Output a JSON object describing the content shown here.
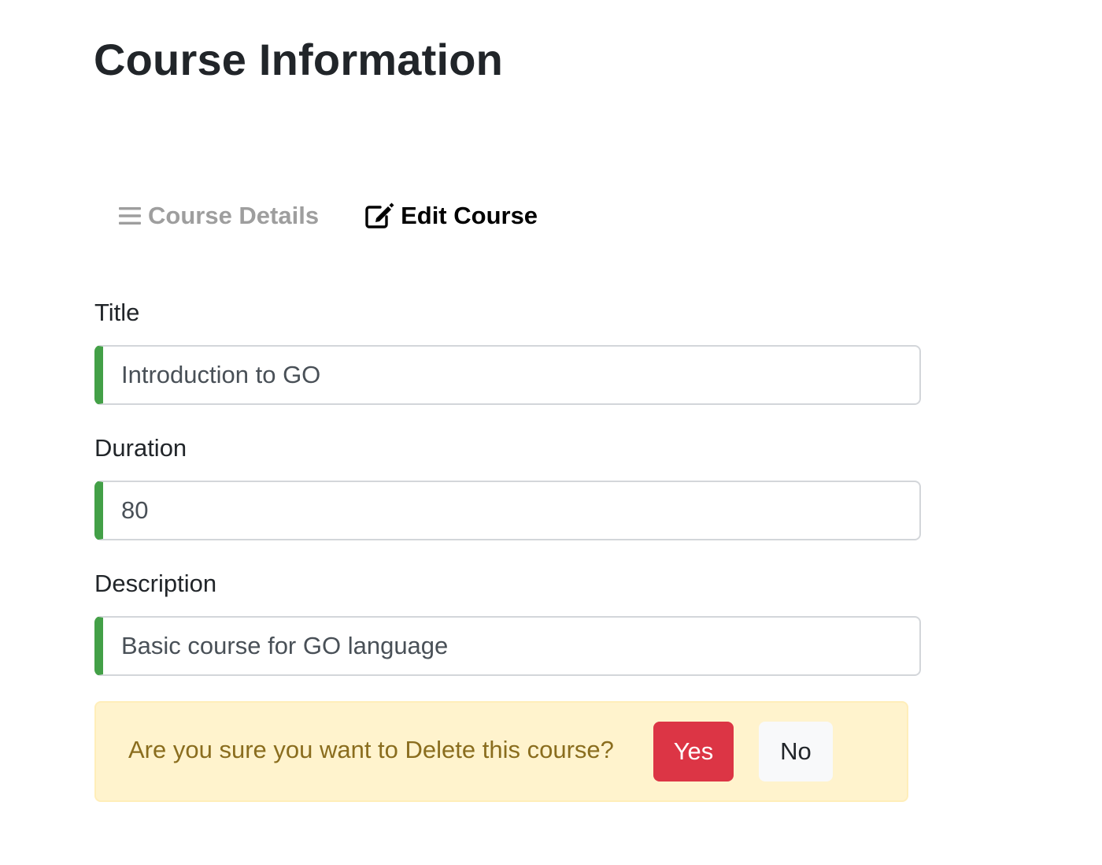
{
  "page": {
    "title": "Course Information"
  },
  "tabs": [
    {
      "label": "Course Details",
      "icon": "bars-icon",
      "active": false
    },
    {
      "label": "Edit Course",
      "icon": "edit-icon",
      "active": true
    }
  ],
  "form": {
    "title": {
      "label": "Title",
      "value": "Introduction to GO"
    },
    "duration": {
      "label": "Duration",
      "value": "80"
    },
    "description": {
      "label": "Description",
      "value": "Basic course for GO language"
    }
  },
  "confirm_delete": {
    "message": "Are you sure you want to Delete this course?",
    "yes_label": "Yes",
    "no_label": "No"
  },
  "colors": {
    "valid_accent": "#43a047",
    "alert_bg": "#fff3cd",
    "alert_text": "#8a6d1e",
    "danger": "#dc3545",
    "inactive_tab": "#9e9e9e"
  }
}
